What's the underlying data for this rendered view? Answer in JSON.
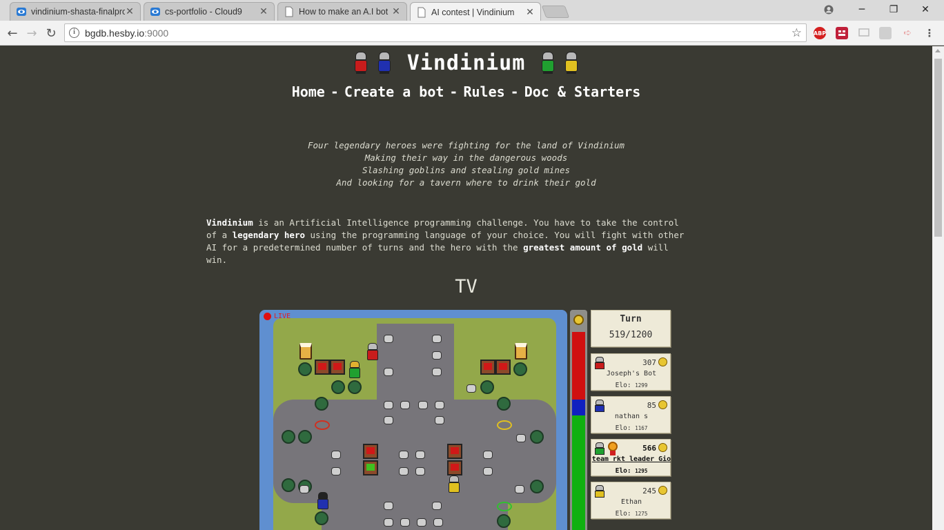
{
  "browser": {
    "tabs": [
      {
        "title": "vindinium-shasta-finalpro",
        "active": false
      },
      {
        "title": "cs-portfolio - Cloud9",
        "active": false
      },
      {
        "title": "How to make an A.I bot",
        "active": false
      },
      {
        "title": "AI contest | Vindinium",
        "active": true
      }
    ],
    "url_host": "bgdb.hesby.io",
    "url_port": ":9000",
    "extensions": [
      "ABP"
    ]
  },
  "site": {
    "title": "Vindinium",
    "nav": [
      "Home",
      "Create a bot",
      "Rules",
      "Doc & Starters"
    ],
    "nav_sep": "-"
  },
  "poem": [
    "Four legendary heroes were fighting for the land of Vindinium",
    "Making their way in the dangerous woods",
    "Slashing goblins and stealing gold mines",
    "And looking for a tavern where to drink their gold"
  ],
  "intro": {
    "p1_bold": "Vindinium",
    "p2": " is an Artificial Intelligence programming challenge. You have to take the control of a ",
    "p3_bold": "legendary hero",
    "p4": " using the programming language of your choice. You will fight with other AI for a predetermined number of turns and the hero with the ",
    "p5_bold": "greatest amount of gold",
    "p6": " will win."
  },
  "tv": {
    "title": "TV",
    "live_label": "LIVE",
    "turn_label": "Turn",
    "turn_value": "519/1200",
    "gold_shares": [
      {
        "color": "#d01010",
        "share": 0.34
      },
      {
        "color": "#1020c0",
        "share": 0.08
      },
      {
        "color": "#10b010",
        "share": 0.58
      }
    ],
    "players": [
      {
        "gold": "307",
        "name": "Joseph's Bot",
        "elo_label": "Elo:",
        "elo": "1299",
        "color": "#c81c1c",
        "leader": false
      },
      {
        "gold": "85",
        "name": "nathan s",
        "elo_label": "Elo:",
        "elo": "1167",
        "color": "#2030b0",
        "leader": false
      },
      {
        "gold": "566",
        "name": "team rkt leader Gio",
        "elo_label": "Elo:",
        "elo": "1295",
        "color": "#20a030",
        "leader": true
      },
      {
        "gold": "245",
        "name": "Ethan",
        "elo_label": "Elo:",
        "elo": "1275",
        "color": "#e0c020",
        "leader": false
      }
    ]
  }
}
